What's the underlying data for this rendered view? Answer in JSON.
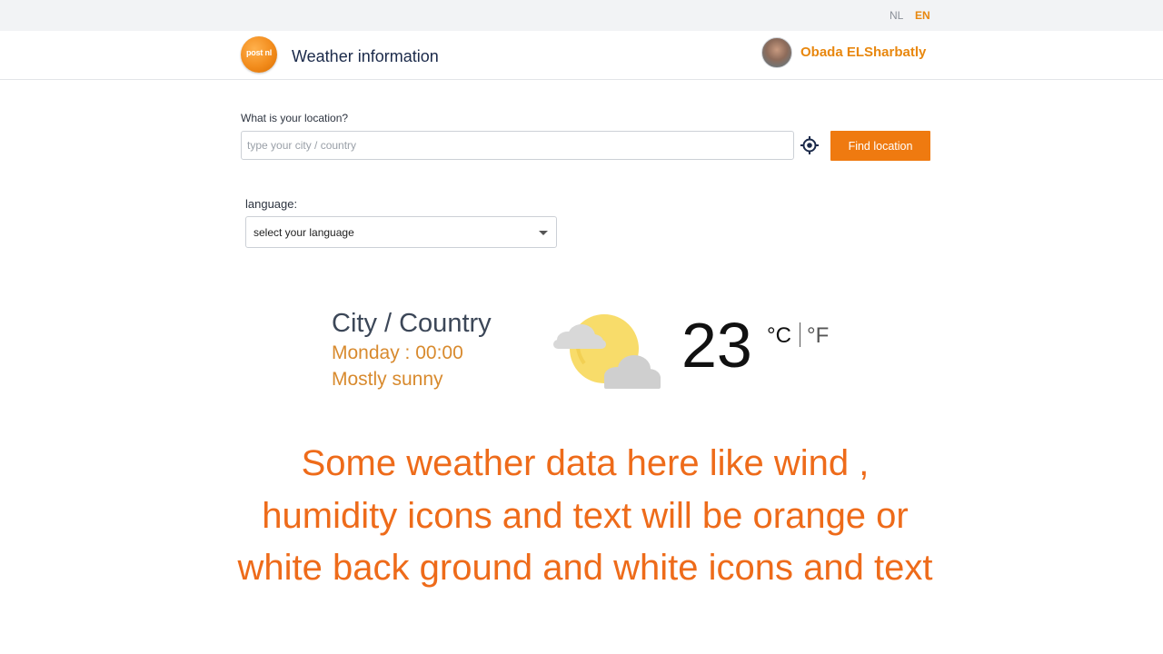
{
  "topbar": {
    "lang_nl": "NL",
    "lang_en": "EN"
  },
  "header": {
    "logo_text": "post nl",
    "app_title": "Weather information",
    "user_name": "Obada ELSharbatly"
  },
  "location": {
    "label": "What is your location?",
    "placeholder": "type your city / country",
    "value": "",
    "find_label": "Find location"
  },
  "language": {
    "label": "language:",
    "selected": "select your language"
  },
  "weather": {
    "city": "City / Country",
    "datetime": "Monday : 00:00",
    "condition": "Mostly sunny",
    "icon": "partly-cloudy-icon",
    "temperature": "23",
    "unit_c": "°C",
    "unit_f": "°F"
  },
  "note": "Some weather data here like wind , humidity icons and text will be orange or white back ground and white icons and text",
  "colors": {
    "accent": "#ef7a10",
    "user_name": "#e8870e",
    "weather_text": "#d88a2e",
    "note": "#ee6b1a"
  }
}
